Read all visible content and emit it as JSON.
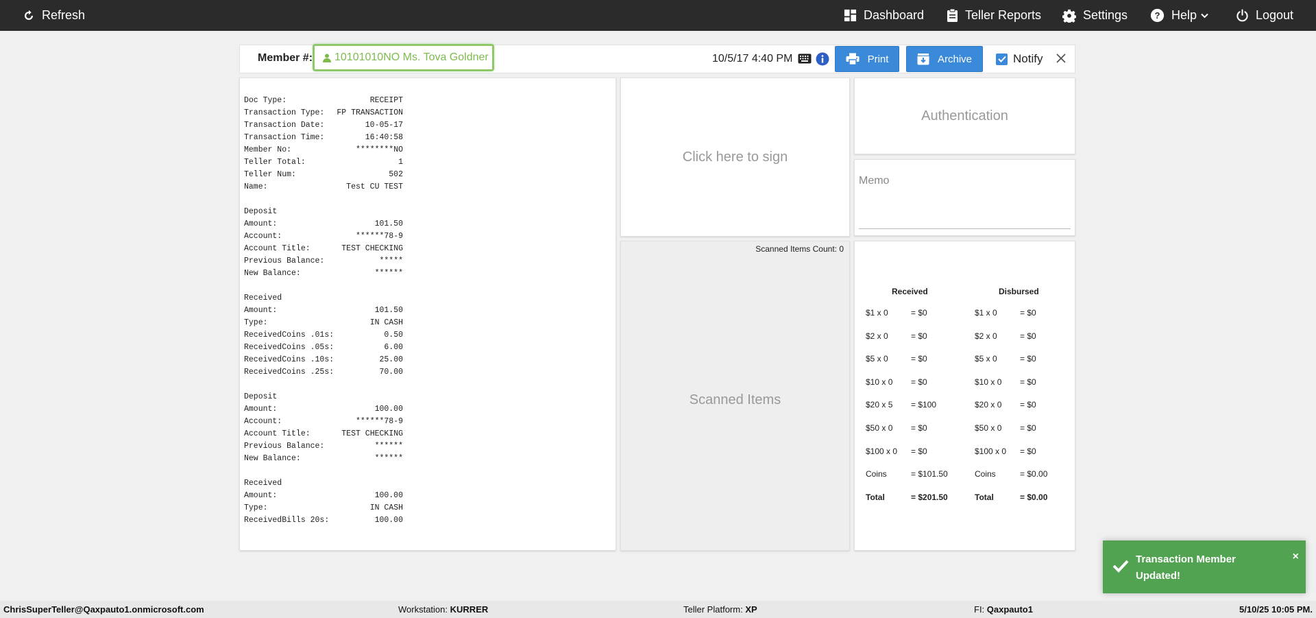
{
  "topbar": {
    "refresh_label": "Refresh",
    "dashboard_label": "Dashboard",
    "teller_reports_label": "Teller Reports",
    "settings_label": "Settings",
    "help_label": "Help",
    "logout_label": "Logout"
  },
  "member": {
    "label": "Member #:",
    "value": "10101010NO Ms. Tova Goldner",
    "datetime": "10/5/17 4:40 PM",
    "print_label": "Print",
    "archive_label": "Archive",
    "notify_label": "Notify",
    "notify_checked": true
  },
  "receipt": {
    "lines": [
      {
        "label": "Doc Type:",
        "value": "RECEIPT"
      },
      {
        "label": "Transaction Type:",
        "value": "FP TRANSACTION"
      },
      {
        "label": "Transaction Date:",
        "value": "10-05-17"
      },
      {
        "label": "Transaction Time:",
        "value": "16:40:58"
      },
      {
        "label": "Member No:",
        "value": "********NO"
      },
      {
        "label": "Teller Total:",
        "value": "1"
      },
      {
        "label": "Teller Num:",
        "value": "502"
      },
      {
        "label": "Name:",
        "value": "Test CU TEST"
      },
      {
        "label": "",
        "value": ""
      },
      {
        "label": "Deposit",
        "value": ""
      },
      {
        "label": "Amount:",
        "value": "101.50"
      },
      {
        "label": "Account:",
        "value": "******78-9"
      },
      {
        "label": "Account Title:",
        "value": "TEST CHECKING"
      },
      {
        "label": "Previous Balance:",
        "value": "*****"
      },
      {
        "label": "New Balance:",
        "value": "******"
      },
      {
        "label": "",
        "value": ""
      },
      {
        "label": "Received",
        "value": ""
      },
      {
        "label": "Amount:",
        "value": "101.50"
      },
      {
        "label": "Type:",
        "value": "IN CASH"
      },
      {
        "label": "ReceivedCoins .01s:",
        "value": "0.50"
      },
      {
        "label": "ReceivedCoins .05s:",
        "value": "6.00"
      },
      {
        "label": "ReceivedCoins .10s:",
        "value": "25.00"
      },
      {
        "label": "ReceivedCoins .25s:",
        "value": "70.00"
      },
      {
        "label": "",
        "value": ""
      },
      {
        "label": "Deposit",
        "value": ""
      },
      {
        "label": "Amount:",
        "value": "100.00"
      },
      {
        "label": "Account:",
        "value": "******78-9"
      },
      {
        "label": "Account Title:",
        "value": "TEST CHECKING"
      },
      {
        "label": "Previous Balance:",
        "value": "******"
      },
      {
        "label": "New Balance:",
        "value": "******"
      },
      {
        "label": "",
        "value": ""
      },
      {
        "label": "Received",
        "value": ""
      },
      {
        "label": "Amount:",
        "value": "100.00"
      },
      {
        "label": "Type:",
        "value": "IN CASH"
      },
      {
        "label": "ReceivedBills 20s:",
        "value": "100.00"
      }
    ]
  },
  "signature": {
    "label": "Click here to sign"
  },
  "scanned": {
    "count_label": "Scanned Items Count: 0",
    "label": "Scanned Items"
  },
  "authentication": {
    "label": "Authentication"
  },
  "memo": {
    "label": "Memo"
  },
  "cash": {
    "received_header": "Received",
    "disbursed_header": "Disbursed",
    "rows": [
      {
        "r_label": "$1 x 0",
        "r_value": "= $0",
        "d_label": "$1 x 0",
        "d_value": "= $0",
        "bold": false
      },
      {
        "r_label": "$2 x 0",
        "r_value": "= $0",
        "d_label": "$2 x 0",
        "d_value": "= $0",
        "bold": false
      },
      {
        "r_label": "$5 x 0",
        "r_value": "= $0",
        "d_label": "$5 x 0",
        "d_value": "= $0",
        "bold": false
      },
      {
        "r_label": "$10 x 0",
        "r_value": "= $0",
        "d_label": "$10 x 0",
        "d_value": "= $0",
        "bold": false
      },
      {
        "r_label": "$20 x 5",
        "r_value": "= $100",
        "d_label": "$20 x 0",
        "d_value": "= $0",
        "bold": false
      },
      {
        "r_label": "$50 x 0",
        "r_value": "= $0",
        "d_label": "$50 x 0",
        "d_value": "= $0",
        "bold": false
      },
      {
        "r_label": "$100 x 0",
        "r_value": "= $0",
        "d_label": "$100 x 0",
        "d_value": "= $0",
        "bold": false
      },
      {
        "r_label": "Coins",
        "r_value": "= $101.50",
        "d_label": "Coins",
        "d_value": "= $0.00",
        "bold": false
      },
      {
        "r_label": "Total",
        "r_value": "= $201.50",
        "d_label": "Total",
        "d_value": "= $0.00",
        "bold": true
      }
    ]
  },
  "toast": {
    "message": "Transaction Member Updated!",
    "close": "×"
  },
  "footer": {
    "user": "ChrisSuperTeller@Qaxpauto1.onmicrosoft.com",
    "workstation_label": "Workstation:",
    "workstation_value": "KURRER",
    "platform_label": "Teller Platform:",
    "platform_value": "XP",
    "fi_label": "FI:",
    "fi_value": "Qaxpauto1",
    "datetime": "5/10/25 10:05 PM."
  }
}
